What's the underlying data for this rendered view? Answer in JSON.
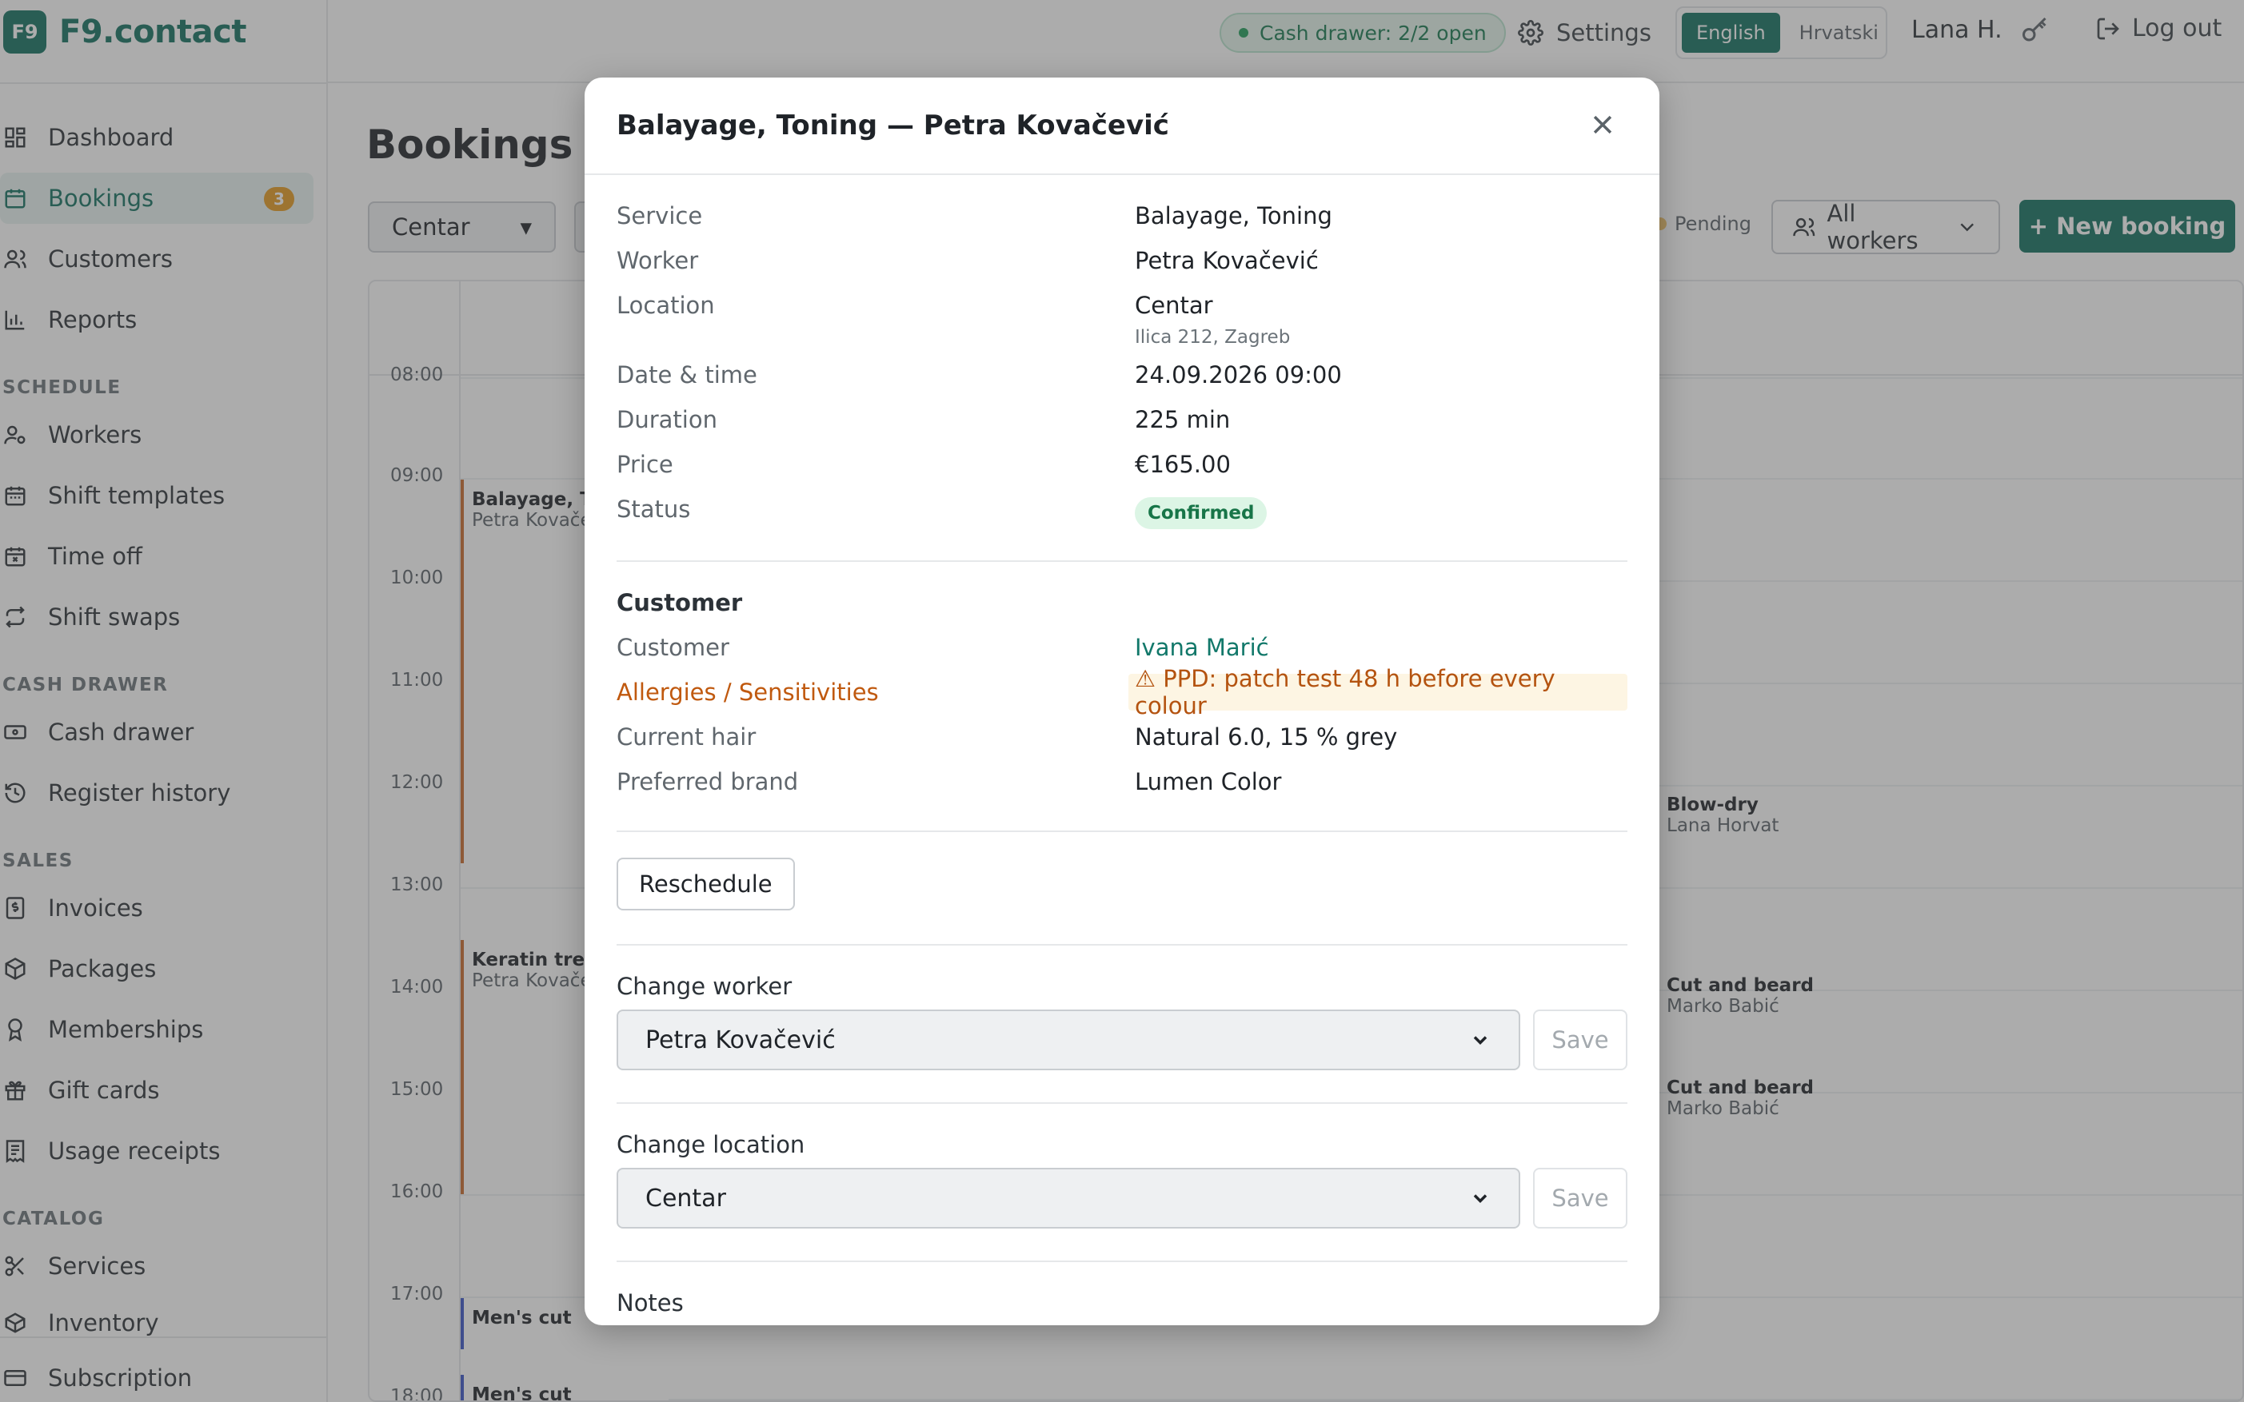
{
  "brand": {
    "logo": "F9",
    "name": "F9.contact"
  },
  "sidebar": {
    "items": [
      {
        "label": "Dashboard",
        "icon": "dashboard-icon"
      },
      {
        "label": "Bookings",
        "icon": "calendar-icon",
        "badge": "3",
        "active": true
      },
      {
        "label": "Customers",
        "icon": "users-icon"
      },
      {
        "label": "Reports",
        "icon": "bar-chart-icon"
      }
    ],
    "sections": [
      {
        "title": "SCHEDULE",
        "items": [
          {
            "label": "Workers",
            "icon": "user-cog-icon"
          },
          {
            "label": "Shift templates",
            "icon": "calendar-icon"
          },
          {
            "label": "Time off",
            "icon": "calendar-x-icon"
          },
          {
            "label": "Shift swaps",
            "icon": "repeat-icon"
          }
        ]
      },
      {
        "title": "CASH DRAWER",
        "items": [
          {
            "label": "Cash drawer",
            "icon": "banknote-icon"
          },
          {
            "label": "Register history",
            "icon": "history-icon"
          }
        ]
      },
      {
        "title": "SALES",
        "items": [
          {
            "label": "Invoices",
            "icon": "invoice-icon"
          },
          {
            "label": "Packages",
            "icon": "package-icon"
          },
          {
            "label": "Memberships",
            "icon": "award-icon"
          },
          {
            "label": "Gift cards",
            "icon": "gift-icon"
          },
          {
            "label": "Usage receipts",
            "icon": "receipt-icon"
          }
        ]
      },
      {
        "title": "CATALOG",
        "items": [
          {
            "label": "Services",
            "icon": "scissors-icon"
          },
          {
            "label": "Inventory",
            "icon": "box-icon"
          }
        ]
      }
    ],
    "footer": {
      "label": "Subscription",
      "icon": "credit-card-icon"
    }
  },
  "topbar": {
    "cash_drawer": "Cash drawer: 2/2 open",
    "settings": "Settings",
    "languages": [
      "English",
      "Hrvatski"
    ],
    "active_language": "English",
    "user": "Lana H.",
    "logout": "Log out"
  },
  "page": {
    "title": "Bookings",
    "location_filter": "Centar",
    "legend_pending": "Pending",
    "workers_filter": "All workers",
    "new_booking": "+ New booking"
  },
  "calendar": {
    "hours": [
      "08:00",
      "09:00",
      "10:00",
      "11:00",
      "12:00",
      "13:00",
      "14:00",
      "15:00",
      "16:00",
      "17:00",
      "18:00"
    ],
    "left_events": [
      {
        "title": "Balayage, To",
        "worker": "Petra Kovače"
      },
      {
        "title": "Keratin treatm",
        "worker": "Petra Kovače"
      },
      {
        "title": "Men's cut",
        "worker": ""
      },
      {
        "title": "Men's cut",
        "worker": ""
      }
    ],
    "right_events": [
      {
        "title": "Blow-dry",
        "worker": "Lana Horvat"
      },
      {
        "title": "Cut and beard",
        "worker": "Marko Babić"
      },
      {
        "title": "Cut and beard",
        "worker": "Marko Babić"
      }
    ]
  },
  "modal": {
    "title": "Balayage, Toning — Petra Kovačević",
    "details": [
      {
        "label": "Service",
        "value": "Balayage, Toning"
      },
      {
        "label": "Worker",
        "value": "Petra Kovačević"
      },
      {
        "label": "Location",
        "value": "Centar",
        "sub": "Ilica 212, Zagreb"
      },
      {
        "label": "Date & time",
        "value": "24.09.2026 09:00"
      },
      {
        "label": "Duration",
        "value": "225 min"
      },
      {
        "label": "Price",
        "value": "€165.00"
      },
      {
        "label": "Status",
        "value": "Confirmed"
      }
    ],
    "customer_section": {
      "title": "Customer",
      "customer_label": "Customer",
      "customer_value": "Ivana Marić",
      "allergies_label": "Allergies / Sensitivities",
      "allergies_value": "⚠ PPD: patch test 48 h before every colour",
      "hair_label": "Current hair",
      "hair_value": "Natural 6.0, 15 % grey",
      "brand_label": "Preferred brand",
      "brand_value": "Lumen Color"
    },
    "reschedule": "Reschedule",
    "change_worker": {
      "label": "Change worker",
      "value": "Petra Kovačević",
      "save": "Save"
    },
    "change_location": {
      "label": "Change location",
      "value": "Centar",
      "save": "Save"
    },
    "notes_title": "Notes"
  },
  "colors": {
    "accent": "#12705f",
    "badge": "#e49a1f",
    "status_confirmed": "#dcf5e5",
    "warning": "#c0590f"
  }
}
